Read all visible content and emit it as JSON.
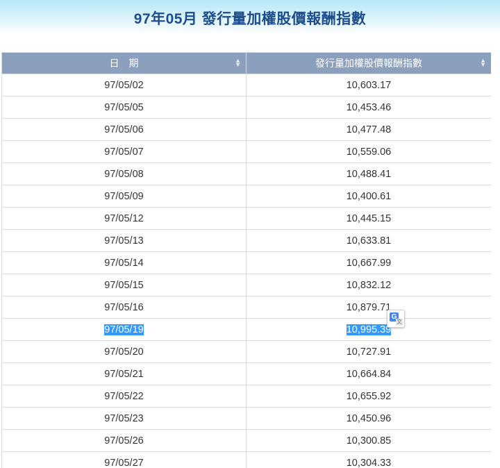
{
  "page": {
    "title": "97年05月 發行量加權股價報酬指數"
  },
  "table": {
    "headers": [
      "日　期",
      "發行量加權股價報酬指數"
    ],
    "rows": [
      {
        "date": "97/05/02",
        "value": "10,603.17"
      },
      {
        "date": "97/05/05",
        "value": "10,453.46"
      },
      {
        "date": "97/05/06",
        "value": "10,477.48"
      },
      {
        "date": "97/05/07",
        "value": "10,559.06"
      },
      {
        "date": "97/05/08",
        "value": "10,488.41"
      },
      {
        "date": "97/05/09",
        "value": "10,400.61"
      },
      {
        "date": "97/05/12",
        "value": "10,445.15"
      },
      {
        "date": "97/05/13",
        "value": "10,633.81"
      },
      {
        "date": "97/05/14",
        "value": "10,667.99"
      },
      {
        "date": "97/05/15",
        "value": "10,832.12"
      },
      {
        "date": "97/05/16",
        "value": "10,879.71"
      },
      {
        "date": "97/05/19",
        "value": "10,995.39",
        "selected": true
      },
      {
        "date": "97/05/20",
        "value": "10,727.91"
      },
      {
        "date": "97/05/21",
        "value": "10,664.84"
      },
      {
        "date": "97/05/22",
        "value": "10,655.92"
      },
      {
        "date": "97/05/23",
        "value": "10,450.96"
      },
      {
        "date": "97/05/26",
        "value": "10,300.85"
      },
      {
        "date": "97/05/27",
        "value": "10,304.33"
      }
    ]
  },
  "colors": {
    "title": "#1d4d8f",
    "header_bg": "#8ba0bc",
    "selection": "#3399ff"
  },
  "icons": {
    "sort": "sort-arrows-icon",
    "translate": "google-translate-icon"
  }
}
